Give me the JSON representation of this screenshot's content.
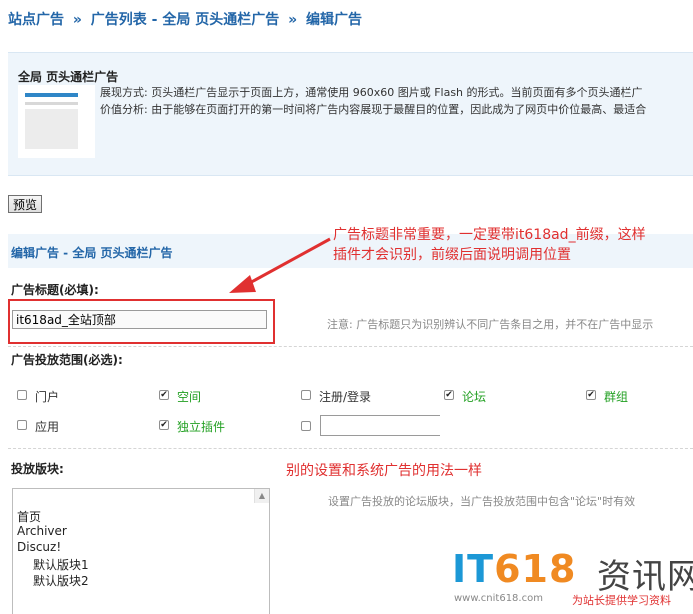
{
  "breadcrumb": {
    "item1": "站点广告",
    "sep": "»",
    "item2": "广告列表 - 全局 页头通栏广告",
    "item3": "编辑广告"
  },
  "info": {
    "title": "全局 页头通栏广告",
    "line1": "展现方式: 页头通栏广告显示于页面上方，通常使用 960x60 图片或 Flash 的形式。当前页面有多个页头通栏广",
    "line2": "价值分析: 由于能够在页面打开的第一时间将广告内容展现于最醒目的位置，因此成为了网页中价位最高、最适合"
  },
  "preview_button": "预览",
  "edit_section_title": "编辑广告 - 全局 页头通栏广告",
  "annotation1": {
    "line1": "广告标题非常重要，一定要带it618ad_前缀，这样",
    "line2": "插件才会识别，前缀后面说明调用位置"
  },
  "ad_title": {
    "label": "广告标题(必填):",
    "value": "it618ad_全站顶部",
    "hint": "注意: 广告标题只为识别辨认不同广告条目之用，并不在广告中显示"
  },
  "scope": {
    "label": "广告投放范围(必选):",
    "options": [
      {
        "label": "门户",
        "checked": false
      },
      {
        "label": "空间",
        "checked": true
      },
      {
        "label": "注册/登录",
        "checked": false
      },
      {
        "label": "论坛",
        "checked": true
      },
      {
        "label": "群组",
        "checked": true
      },
      {
        "label": "应用",
        "checked": false
      },
      {
        "label": "独立插件",
        "checked": true
      }
    ]
  },
  "forums": {
    "label": "投放版块:",
    "annotation": "别的设置和系统广告的用法一样",
    "hint": "设置广告投放的论坛版块，当广告投放范围中包含\"论坛\"时有效",
    "items": [
      "首页",
      "Archiver",
      "Discuz!",
      "默认版块1",
      "默认版块2"
    ]
  },
  "watermark": {
    "logo_it": "IT",
    "logo_num": "618",
    "logo_cn": "资讯网",
    "url": "www.cnit618.com",
    "slogan": "为站长提供学习资料"
  },
  "colors": {
    "link_blue": "#2366a8",
    "annotation_red": "#e03030",
    "option_green": "#23a023",
    "panel_bg": "#eef5fb"
  }
}
